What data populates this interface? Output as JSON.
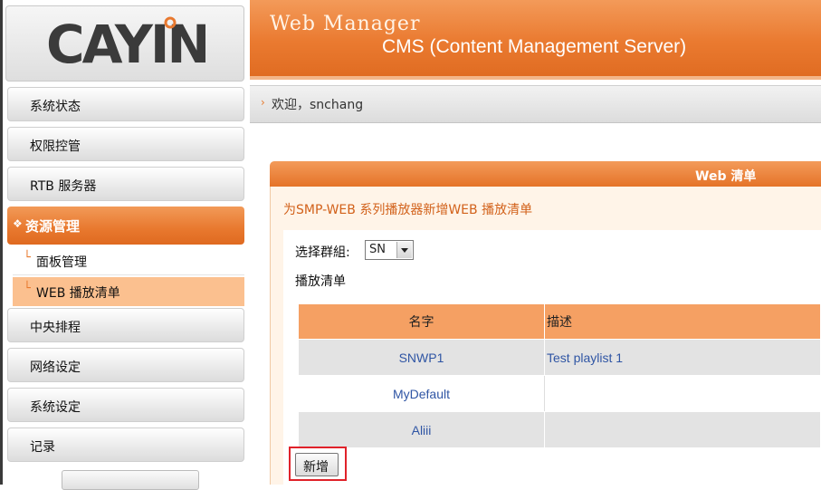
{
  "logo": {
    "text": "CAYIN"
  },
  "header": {
    "title": "Web Manager",
    "subtitle": "CMS (Content Management Server)"
  },
  "welcome": {
    "text": "欢迎，snchang"
  },
  "sidebar": {
    "items": [
      {
        "label": "系统状态"
      },
      {
        "label": "权限控管"
      },
      {
        "label": "RTB 服务器"
      },
      {
        "label": "资源管理",
        "active": true
      },
      {
        "label": "中央排程"
      },
      {
        "label": "网络设定"
      },
      {
        "label": "系统设定"
      },
      {
        "label": "记录"
      }
    ],
    "subitems": [
      {
        "label": "面板管理"
      },
      {
        "label": "WEB 播放清单",
        "selected": true
      }
    ]
  },
  "panel": {
    "title": "Web 清单",
    "subtitle": "为SMP-WEB 系列播放器新增WEB 播放清单",
    "group_label": "选择群組:",
    "group_value": "SN",
    "playlist_label": "播放清单",
    "columns": [
      "名字",
      "描述"
    ],
    "rows": [
      {
        "name": "SNWP1",
        "description": "Test playlist 1"
      },
      {
        "name": "MyDefault",
        "description": ""
      },
      {
        "name": "Aliii",
        "description": ""
      }
    ],
    "add_button": "新增"
  },
  "colors": {
    "accent_orange": "#e8782e",
    "link_blue": "#2f55a4",
    "highlight_red": "#e0222a"
  }
}
